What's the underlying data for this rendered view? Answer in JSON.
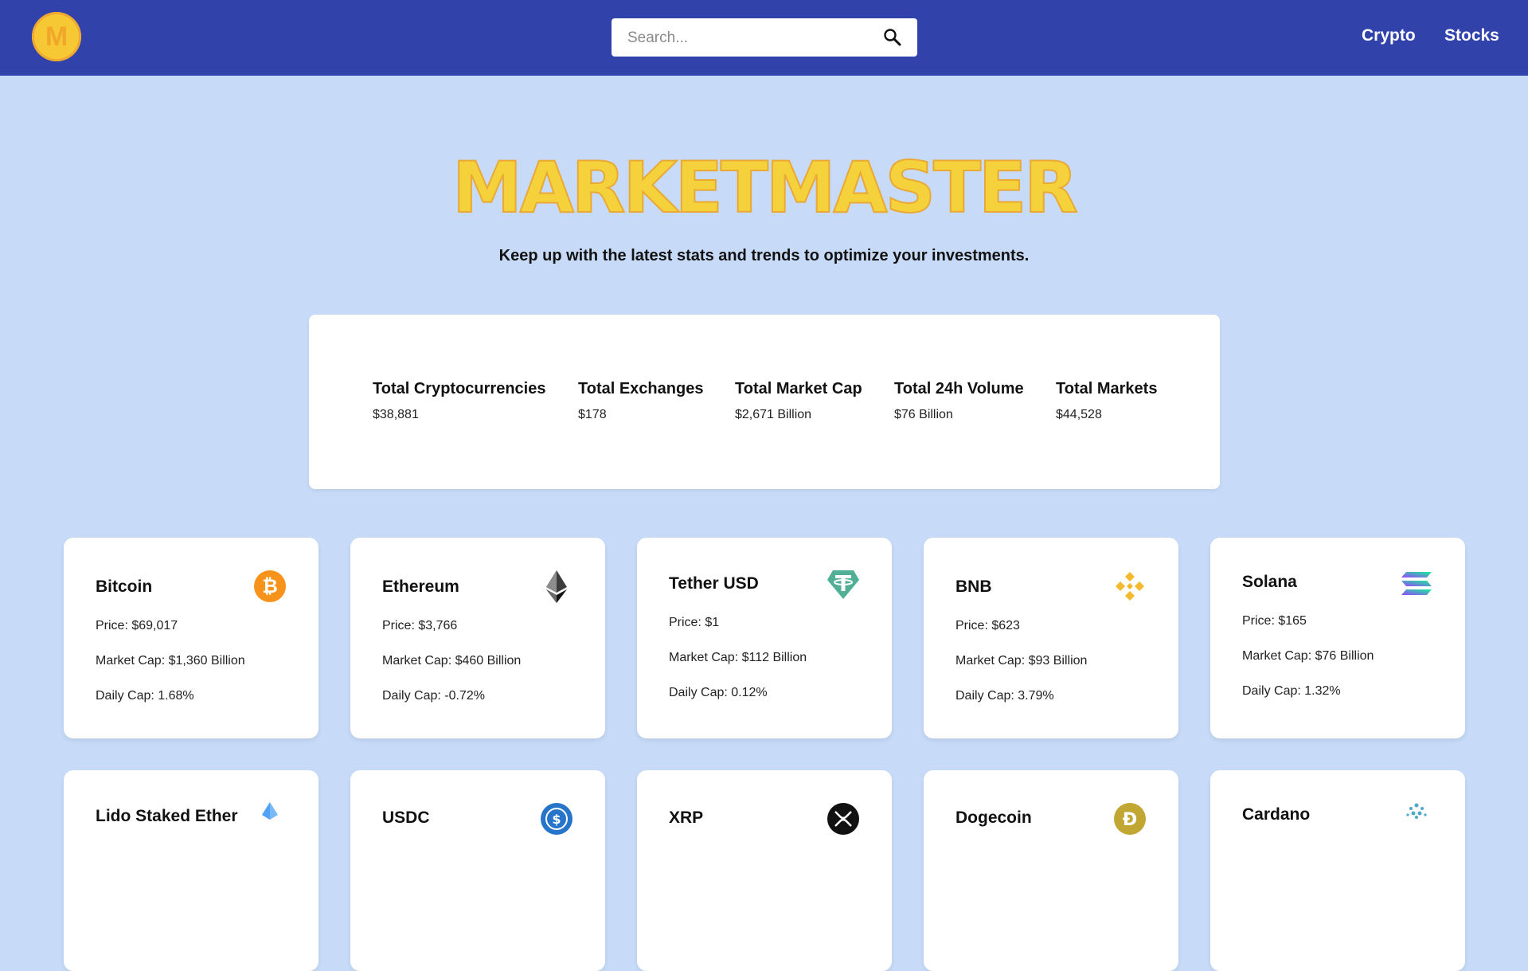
{
  "navbar": {
    "logo_letter": "M",
    "search_placeholder": "Search...",
    "links": [
      "Crypto",
      "Stocks"
    ]
  },
  "hero": {
    "title": "MARKETMASTER",
    "subtitle": "Keep up with the latest stats and trends to optimize your investments."
  },
  "stats": [
    {
      "label": "Total Cryptocurrencies",
      "value": "$38,881"
    },
    {
      "label": "Total Exchanges",
      "value": "$178"
    },
    {
      "label": "Total Market Cap",
      "value": "$2,671 Billion"
    },
    {
      "label": "Total 24h Volume",
      "value": "$76 Billion"
    },
    {
      "label": "Total Markets",
      "value": "$44,528"
    }
  ],
  "coins": [
    {
      "name": "Bitcoin",
      "price": "Price: $69,017",
      "market_cap": "Market Cap: $1,360 Billion",
      "daily_cap": "Daily Cap: 1.68%",
      "icon": "bitcoin-icon",
      "color": "#f7931a"
    },
    {
      "name": "Ethereum",
      "price": "Price: $3,766",
      "market_cap": "Market Cap: $460 Billion",
      "daily_cap": "Daily Cap: -0.72%",
      "icon": "ethereum-icon",
      "color": "#3c3c3d"
    },
    {
      "name": "Tether USD",
      "price": "Price: $1",
      "market_cap": "Market Cap: $112 Billion",
      "daily_cap": "Daily Cap: 0.12%",
      "icon": "tether-icon",
      "color": "#50af95"
    },
    {
      "name": "BNB",
      "price": "Price: $623",
      "market_cap": "Market Cap: $93 Billion",
      "daily_cap": "Daily Cap: 3.79%",
      "icon": "bnb-icon",
      "color": "#f3ba2f"
    },
    {
      "name": "Solana",
      "price": "Price: $165",
      "market_cap": "Market Cap: $76 Billion",
      "daily_cap": "Daily Cap: 1.32%",
      "icon": "solana-icon",
      "color": "#9945ff"
    },
    {
      "name": "Lido Staked Ether",
      "icon": "lido-icon",
      "color": "#4fa3f7"
    },
    {
      "name": "USDC",
      "icon": "usdc-icon",
      "color": "#2775ca"
    },
    {
      "name": "XRP",
      "icon": "xrp-icon",
      "color": "#111111"
    },
    {
      "name": "Dogecoin",
      "icon": "dogecoin-icon",
      "color": "#c2a633"
    },
    {
      "name": "Cardano",
      "icon": "cardano-icon",
      "color": "#4da8c9"
    }
  ]
}
